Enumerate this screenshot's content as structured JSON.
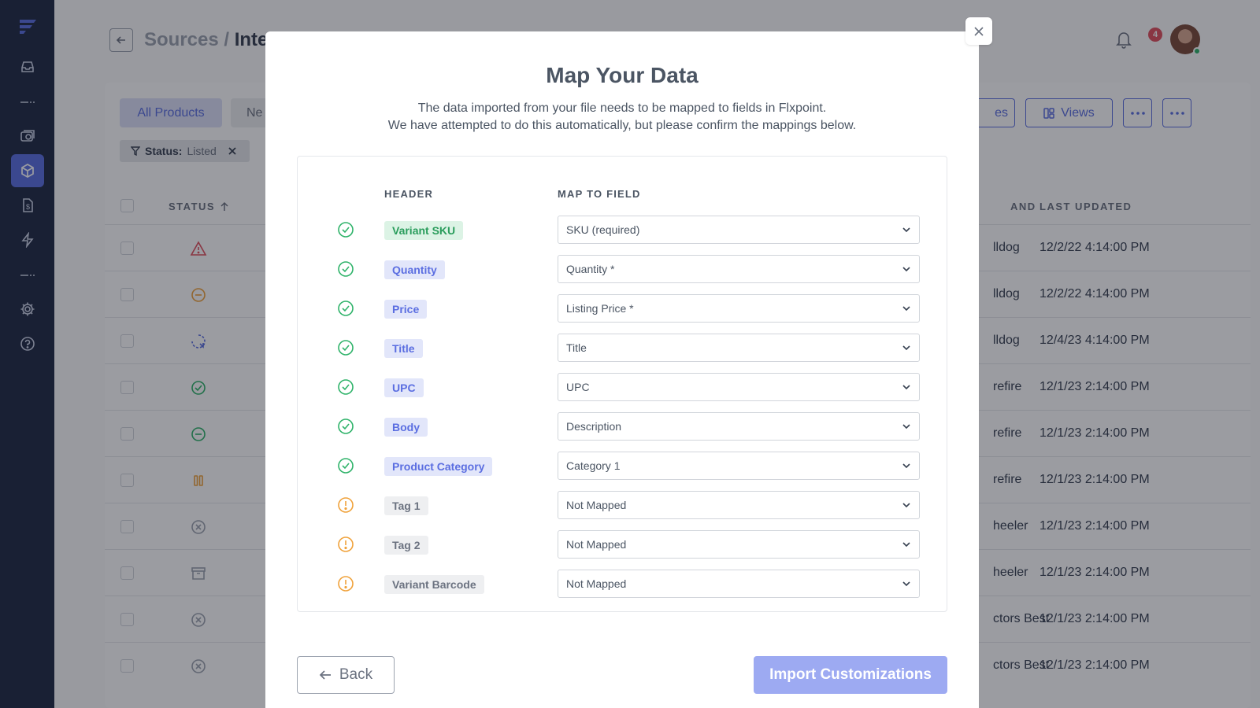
{
  "app": {
    "logo_icon": "flxpoint-logo"
  },
  "sidebar": {
    "items": [
      {
        "icon": "inbox-icon",
        "active": false
      },
      {
        "icon": "separator",
        "active": false
      },
      {
        "icon": "orders-icon",
        "active": false
      },
      {
        "icon": "box-icon",
        "active": true
      },
      {
        "icon": "invoice-icon",
        "active": false
      },
      {
        "icon": "bolt-icon",
        "active": false
      },
      {
        "icon": "separator",
        "active": false
      },
      {
        "icon": "gear-icon",
        "active": false
      },
      {
        "icon": "help-icon",
        "active": false
      }
    ]
  },
  "header": {
    "breadcrumb_root": "Sources /",
    "breadcrumb_current": "Inter",
    "notification_count": "4"
  },
  "toolbar": {
    "tab_all": "All Products",
    "tab_second": "Ne",
    "filter_label": "Status:",
    "filter_value": "Listed",
    "btn_partial": "es",
    "views_label": "Views"
  },
  "table": {
    "col_status": "STATUS",
    "col_brand": "AND",
    "col_updated": "LAST UPDATED",
    "rows": [
      {
        "status": "warning",
        "brand": "lldog",
        "updated": "12/2/22 4:14:00 PM"
      },
      {
        "status": "minus-orange",
        "brand": "lldog",
        "updated": "12/2/22 4:14:00 PM"
      },
      {
        "status": "syncing",
        "brand": "lldog",
        "updated": "12/4/23 4:14:00 PM"
      },
      {
        "status": "check",
        "brand": "refire",
        "updated": "12/1/23 2:14:00 PM"
      },
      {
        "status": "minus-green",
        "brand": "refire",
        "updated": "12/1/23 2:14:00 PM"
      },
      {
        "status": "paused",
        "brand": "refire",
        "updated": "12/1/23 2:14:00 PM"
      },
      {
        "status": "x-circle",
        "brand": "heeler",
        "updated": "12/1/23 2:14:00 PM"
      },
      {
        "status": "archive",
        "brand": "heeler",
        "updated": "12/1/23 2:14:00 PM"
      },
      {
        "status": "x-circle",
        "brand": "ctors Best",
        "updated": "12/1/23 2:14:00 PM"
      },
      {
        "status": "x-circle",
        "brand": "ctors Best",
        "updated": "12/1/23 2:14:00 PM"
      }
    ]
  },
  "modal": {
    "title": "Map Your Data",
    "subtitle_line1": "The data imported from your file needs to be mapped to fields in Flxpoint.",
    "subtitle_line2": "We have attempted to do this automatically, but please confirm the mappings below.",
    "col_header": "HEADER",
    "col_map": "MAP TO FIELD",
    "mappings": [
      {
        "header": "Variant SKU",
        "tag_style": "green",
        "status": "mapped",
        "field": "SKU (required)"
      },
      {
        "header": "Quantity",
        "tag_style": "blue",
        "status": "mapped",
        "field": "Quantity *"
      },
      {
        "header": "Price",
        "tag_style": "blue",
        "status": "mapped",
        "field": "Listing Price *"
      },
      {
        "header": "Title",
        "tag_style": "blue",
        "status": "mapped",
        "field": "Title"
      },
      {
        "header": "UPC",
        "tag_style": "blue",
        "status": "mapped",
        "field": "UPC"
      },
      {
        "header": "Body",
        "tag_style": "blue",
        "status": "mapped",
        "field": "Description"
      },
      {
        "header": "Product Category",
        "tag_style": "blue",
        "status": "mapped",
        "field": "Category 1"
      },
      {
        "header": "Tag 1",
        "tag_style": "gray",
        "status": "unmapped",
        "field": "Not Mapped"
      },
      {
        "header": "Tag 2",
        "tag_style": "gray",
        "status": "unmapped",
        "field": "Not Mapped"
      },
      {
        "header": "Variant Barcode",
        "tag_style": "gray",
        "status": "unmapped",
        "field": "Not Mapped"
      }
    ],
    "back_label": "Back",
    "import_label": "Import Customizations"
  },
  "colors": {
    "sidebar_bg": "#1f2a44",
    "accent": "#5b6ee1",
    "mapped_green": "#2fb36a",
    "warning_orange": "#f0a23b",
    "error_red": "#e0505e"
  }
}
